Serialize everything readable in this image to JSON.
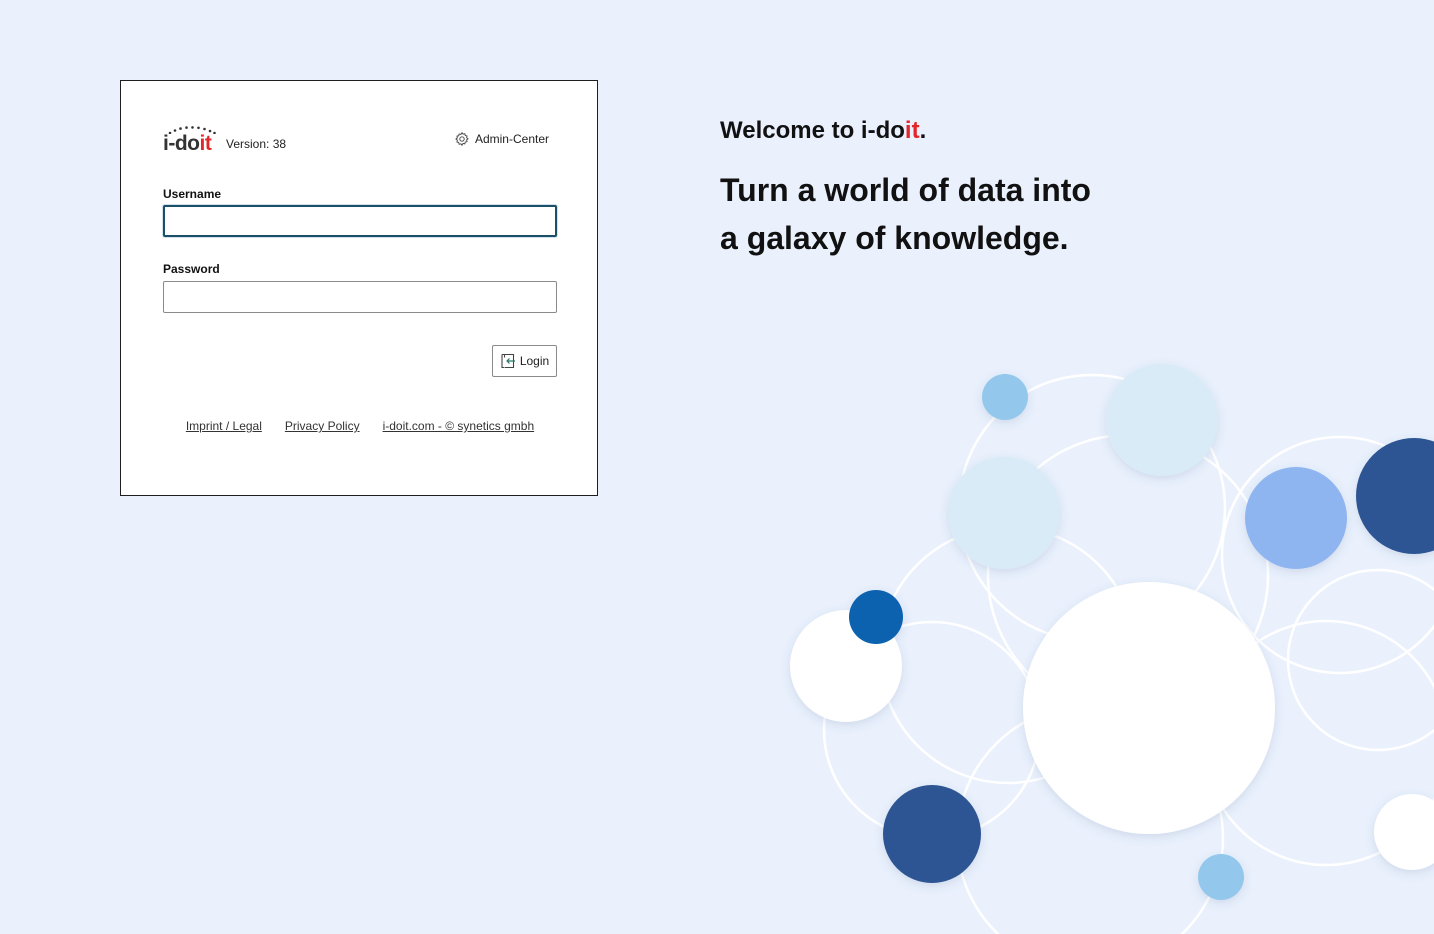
{
  "logo": {
    "dark_part": "i-do",
    "red_part": "it"
  },
  "header": {
    "version_text": "Version: 38",
    "admin_center_label": "Admin-Center"
  },
  "form": {
    "username_label": "Username",
    "username_value": "",
    "password_label": "Password",
    "password_value": "",
    "login_label": "Login"
  },
  "footer": {
    "imprint_label": "Imprint / Legal",
    "privacy_label": "Privacy Policy",
    "company_label": "i-doit.com - © synetics gmbh"
  },
  "welcome": {
    "prefix": "Welcome to ",
    "brand_dark": "i-do",
    "brand_red": "it",
    "suffix": ".",
    "tagline_line1": "Turn a world of data into",
    "tagline_line2": "a galaxy of knowledge."
  },
  "colors": {
    "background": "#eaf1fd",
    "brand_red": "#e3262a",
    "focus_border": "#1b4f6a",
    "bubble_dark_blue": "#2e5593",
    "bubble_mid_blue": "#0a62b0",
    "bubble_light_blue": "#8fb5f1",
    "bubble_sky": "#93c7ec",
    "bubble_pale": "#d8ebf6",
    "bubble_white": "#ffffff"
  }
}
